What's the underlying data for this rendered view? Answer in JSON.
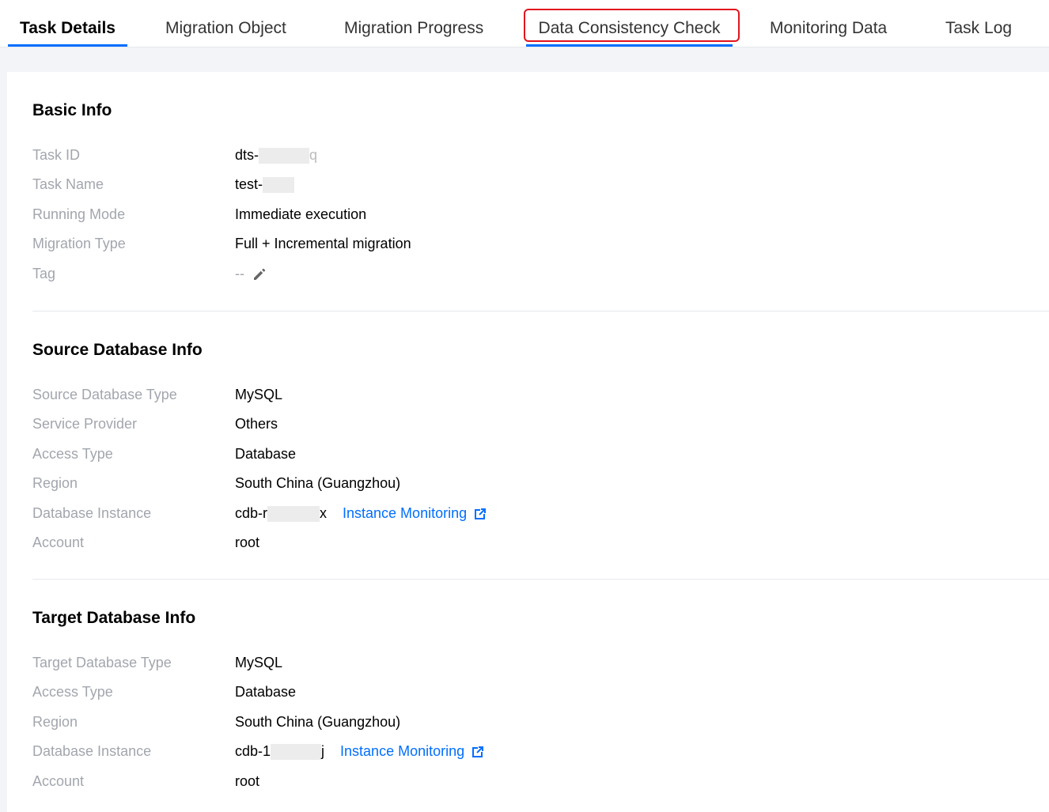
{
  "tabs": [
    {
      "label": "Task Details",
      "active": true
    },
    {
      "label": "Migration Object",
      "active": false
    },
    {
      "label": "Migration Progress",
      "active": false
    },
    {
      "label": "Data Consistency Check",
      "active": false,
      "highlighted": true
    },
    {
      "label": "Monitoring Data",
      "active": false
    },
    {
      "label": "Task Log",
      "active": false
    }
  ],
  "basic_info": {
    "title": "Basic Info",
    "rows": [
      {
        "label": "Task ID",
        "value_prefix": "dts-",
        "value_suffix": "q"
      },
      {
        "label": "Task Name",
        "value_prefix": "test-",
        "value_suffix": ""
      },
      {
        "label": "Running Mode",
        "value": "Immediate execution"
      },
      {
        "label": "Migration Type",
        "value": "Full + Incremental migration"
      },
      {
        "label": "Tag",
        "value": "--"
      }
    ]
  },
  "source_db": {
    "title": "Source Database Info",
    "rows": [
      {
        "label": "Source Database Type",
        "value": "MySQL"
      },
      {
        "label": "Service Provider",
        "value": "Others"
      },
      {
        "label": "Access Type",
        "value": "Database"
      },
      {
        "label": "Region",
        "value": "South China (Guangzhou)"
      },
      {
        "label": "Database Instance",
        "value_prefix": "cdb-r",
        "value_suffix": "x",
        "link": "Instance Monitoring"
      },
      {
        "label": "Account",
        "value": "root"
      }
    ]
  },
  "target_db": {
    "title": "Target Database Info",
    "rows": [
      {
        "label": "Target Database Type",
        "value": "MySQL"
      },
      {
        "label": "Access Type",
        "value": "Database"
      },
      {
        "label": "Region",
        "value": "South China (Guangzhou)"
      },
      {
        "label": "Database Instance",
        "value_prefix": "cdb-1",
        "value_suffix": "j",
        "link": "Instance Monitoring"
      },
      {
        "label": "Account",
        "value": "root"
      }
    ]
  },
  "colors": {
    "accent": "#006eff",
    "highlight": "#e0141e",
    "label": "#a2a6ad"
  }
}
